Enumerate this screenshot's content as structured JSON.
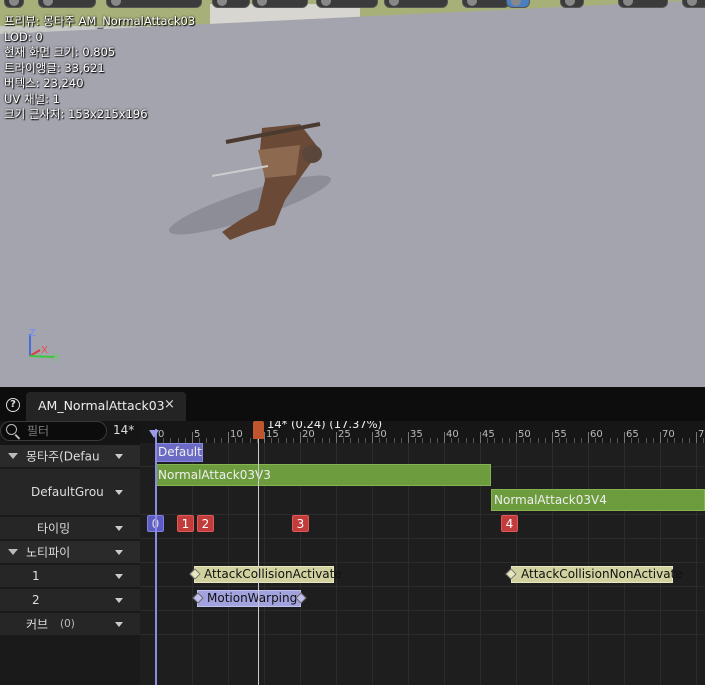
{
  "viewport": {
    "stats": {
      "preview": "프리뷰: 몽타주 AM_NormalAttack03",
      "lod": "LOD: 0",
      "screen_size": "현재 화면 크기: 0.805",
      "triangles": "트라이앵글: 33,621",
      "vertices": "버텍스: 23,240",
      "uv_channels": "UV 채널: 1",
      "approx_size": "크기 근사치: 153x215x196"
    },
    "axis": {
      "z": "Z",
      "x": "X",
      "y": "Y"
    }
  },
  "tab": {
    "help": "?",
    "title": "AM_NormalAttack03",
    "close": "×"
  },
  "search": {
    "placeholder": "필터"
  },
  "current_frame": "14*",
  "playhead": {
    "label": "14* (0.24) (17.37%)",
    "frame": 14
  },
  "ruler_ticks": [
    "0",
    "5",
    "10",
    "15",
    "20",
    "25",
    "30",
    "35",
    "40",
    "45",
    "50",
    "55",
    "60",
    "65",
    "70",
    "7"
  ],
  "tracks": {
    "montage": "몽타주(Defau",
    "default_group": "DefaultGrou",
    "timing": "타이밍",
    "notify": "노티파이",
    "notify1": "1",
    "notify2": "2",
    "curve": "커브",
    "curve_count": "(0)"
  },
  "segments": {
    "default_slot": "Default",
    "clip1": "NormalAttack03V3",
    "clip2": "NormalAttack03V4"
  },
  "timing_markers": [
    "0",
    "1",
    "2",
    "3",
    "4"
  ],
  "notifies": {
    "n1": "AttackCollisionActivate",
    "n2": "AttackCollisionNonActivate",
    "n3": "MotionWarping"
  },
  "colors": {
    "segment_green": "#6d9c3e",
    "default_blue": "#6b6bc6",
    "timing_red": "#c23c3c",
    "notify_yellow": "#d2d2a0",
    "notify_purple": "#a2a2de",
    "playhead_orange": "#c0562e"
  }
}
